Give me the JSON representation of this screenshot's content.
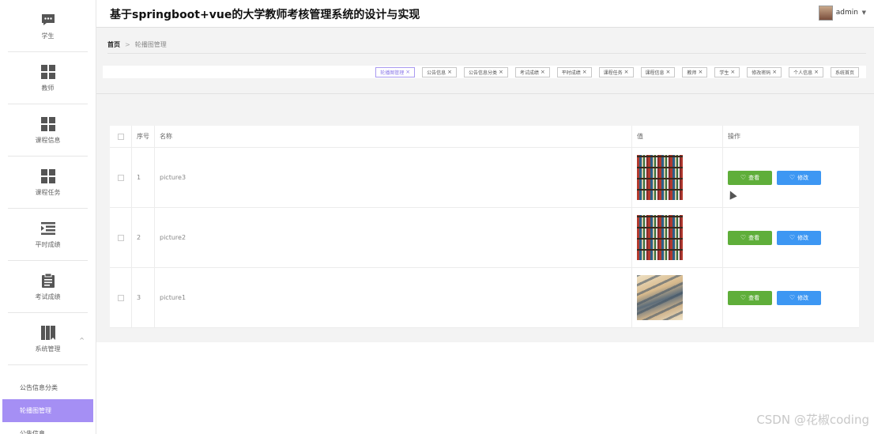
{
  "app": {
    "title": "基于springboot+vue的大学教师考核管理系统的设计与实现",
    "user": "admin"
  },
  "sidebar": {
    "items": [
      {
        "label": "学生",
        "icon": "chat-icon"
      },
      {
        "label": "教师",
        "icon": "grid-icon"
      },
      {
        "label": "课程信息",
        "icon": "grid-icon"
      },
      {
        "label": "课程任务",
        "icon": "grid-icon"
      },
      {
        "label": "平时成绩",
        "icon": "list-indent-icon"
      },
      {
        "label": "考试成绩",
        "icon": "clipboard-icon"
      },
      {
        "label": "系统管理",
        "icon": "book-icon",
        "expanded": true
      }
    ],
    "submenu": [
      {
        "label": "公告信息分类",
        "active": false
      },
      {
        "label": "轮播图管理",
        "active": true
      },
      {
        "label": "公告信息",
        "active": false
      }
    ]
  },
  "breadcrumb": {
    "home": "首页",
    "separator": ">",
    "current": "轮播图管理"
  },
  "tags": [
    {
      "label": "轮播图管理",
      "active": true
    },
    {
      "label": "公告信息",
      "active": false
    },
    {
      "label": "公告信息分类",
      "active": false
    },
    {
      "label": "考试成绩",
      "active": false
    },
    {
      "label": "平时成绩",
      "active": false
    },
    {
      "label": "课程任务",
      "active": false
    },
    {
      "label": "课程信息",
      "active": false
    },
    {
      "label": "教师",
      "active": false
    },
    {
      "label": "学生",
      "active": false
    },
    {
      "label": "修改密码",
      "active": false
    },
    {
      "label": "个人信息",
      "active": false
    },
    {
      "label": "系统首页",
      "active": false,
      "closable": false
    }
  ],
  "table": {
    "columns": {
      "no": "序号",
      "name": "名称",
      "value": "值",
      "op": "操作"
    },
    "rows": [
      {
        "no": "1",
        "name": "picture3",
        "image": "bookshelf-image"
      },
      {
        "no": "2",
        "name": "picture2",
        "image": "bookshelf-image"
      },
      {
        "no": "3",
        "name": "picture1",
        "image": "building-image"
      }
    ],
    "actions": {
      "view": "查看",
      "edit": "修改"
    }
  },
  "watermark": "CSDN @花椒coding",
  "colors": {
    "accent": "#a58ff4",
    "view_button": "#5fae3a",
    "edit_button": "#3d97f3"
  }
}
